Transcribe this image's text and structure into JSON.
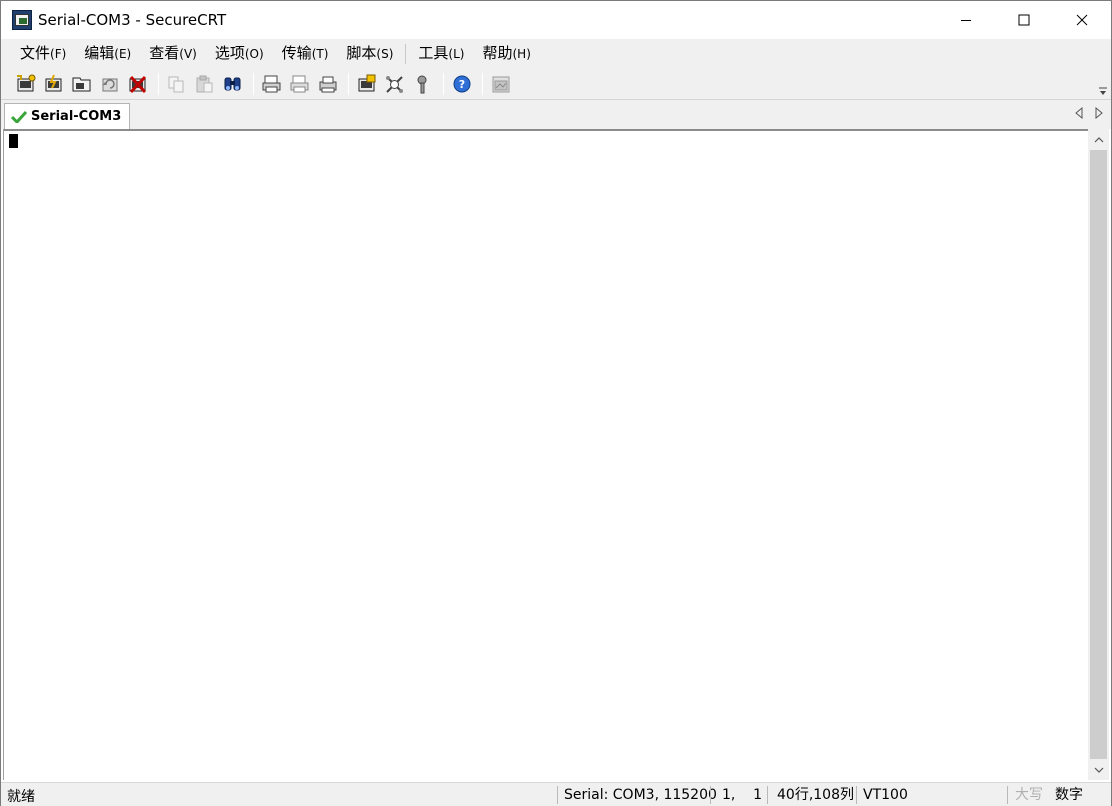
{
  "window": {
    "title": "Serial-COM3 - SecureCRT"
  },
  "menu": [
    {
      "label": "文件",
      "accel": "(F)"
    },
    {
      "label": "编辑",
      "accel": "(E)"
    },
    {
      "label": "查看",
      "accel": "(V)"
    },
    {
      "label": "选项",
      "accel": "(O)"
    },
    {
      "label": "传输",
      "accel": "(T)"
    },
    {
      "label": "脚本",
      "accel": "(S)"
    },
    {
      "label": "工具",
      "accel": "(L)"
    },
    {
      "label": "帮助",
      "accel": "(H)"
    }
  ],
  "toolbar": {
    "icons": [
      "connect-icon",
      "quick-connect-icon",
      "connect-in-tab-icon",
      "reconnect-icon",
      "disconnect-icon",
      "copy-icon",
      "paste-icon",
      "find-icon",
      "print-icon",
      "print-selection-icon",
      "printer-setup-icon",
      "session-options-icon",
      "global-options-icon",
      "keymap-icon",
      "help-icon",
      "sftp-icon"
    ]
  },
  "tabs": [
    {
      "label": "Serial-COM3",
      "status": "connected"
    }
  ],
  "statusbar": {
    "ready": "就绪",
    "connection": "Serial: COM3, 115200",
    "cursor_pos": "1,    1",
    "size": "40行,108列",
    "emulation": "VT100",
    "ime_caps": "大写",
    "ime_num": "数字"
  },
  "colors": {
    "chrome": "#f0f0f0",
    "terminal_bg": "#ffffff",
    "cursor": "#000000"
  }
}
